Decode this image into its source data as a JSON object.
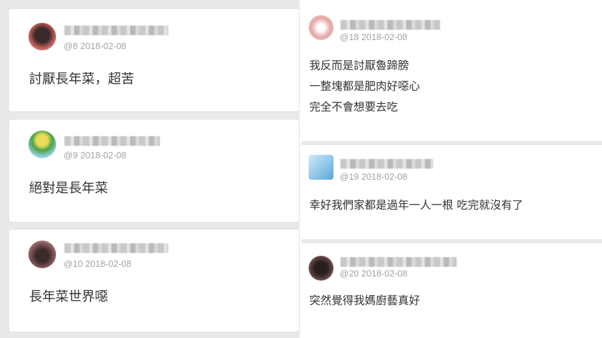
{
  "comments": [
    {
      "floor": "@8 2018-02-08",
      "lines": [
        "討厭長年菜，超苦"
      ],
      "avatar_color": "#b85a55"
    },
    {
      "floor": "@9 2018-02-08",
      "lines": [
        "絕對是長年菜"
      ],
      "avatar_color": "#4aa348"
    },
    {
      "floor": "@10 2018-02-08",
      "lines": [
        "長年菜世界噁"
      ],
      "avatar_color": "#7a5050"
    },
    {
      "floor": "@18 2018-02-08",
      "lines": [
        "我反而是討厭魯蹄膀",
        "一整塊都是肥肉好噁心",
        "完全不會想要去吃"
      ],
      "avatar_color": "#e3a9a6"
    },
    {
      "floor": "@19 2018-02-08",
      "lines": [
        "幸好我們家都是過年一人一根  吃完就沒有了"
      ],
      "avatar_color": "#8ec6e8"
    },
    {
      "floor": "@20 2018-02-08",
      "lines": [
        "突然覺得我媽廚藝真好"
      ],
      "avatar_color": "#5a3d3d"
    }
  ]
}
